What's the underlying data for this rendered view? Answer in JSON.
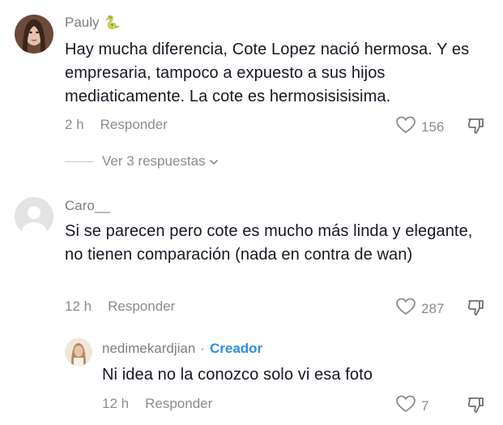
{
  "comments": [
    {
      "username": "Pauly",
      "username_emoji": "🐍",
      "text": "Hay mucha diferencia, Cote Lopez nació hermosa. Y es empresaria, tampoco a expuesto a sus hijos mediaticamente. La cote es hermosisisisima.",
      "time": "2 h",
      "reply_label": "Responder",
      "likes": "156",
      "view_replies": "Ver 3 respuestas"
    },
    {
      "username": "Caro__",
      "text": "Si se parecen pero cote es mucho más linda y elegante, no tienen comparación (nada en contra de wan)",
      "time": "12 h",
      "reply_label": "Responder",
      "likes": "287"
    }
  ],
  "reply": {
    "username": "nedimekardjian",
    "separator": "·",
    "badge": "Creador",
    "text": "Ni idea no la conozco solo vi esa foto",
    "time": "12 h",
    "reply_label": "Responder",
    "likes": "7"
  },
  "icons": {
    "like": "heart-outline-icon",
    "dislike": "thumbs-down-icon",
    "chevron": "chevron-down-icon",
    "verified": "snake-emoji"
  },
  "colors": {
    "text": "#161823",
    "muted": "#8a8a92",
    "creator_badge": "#2f8fd8"
  }
}
